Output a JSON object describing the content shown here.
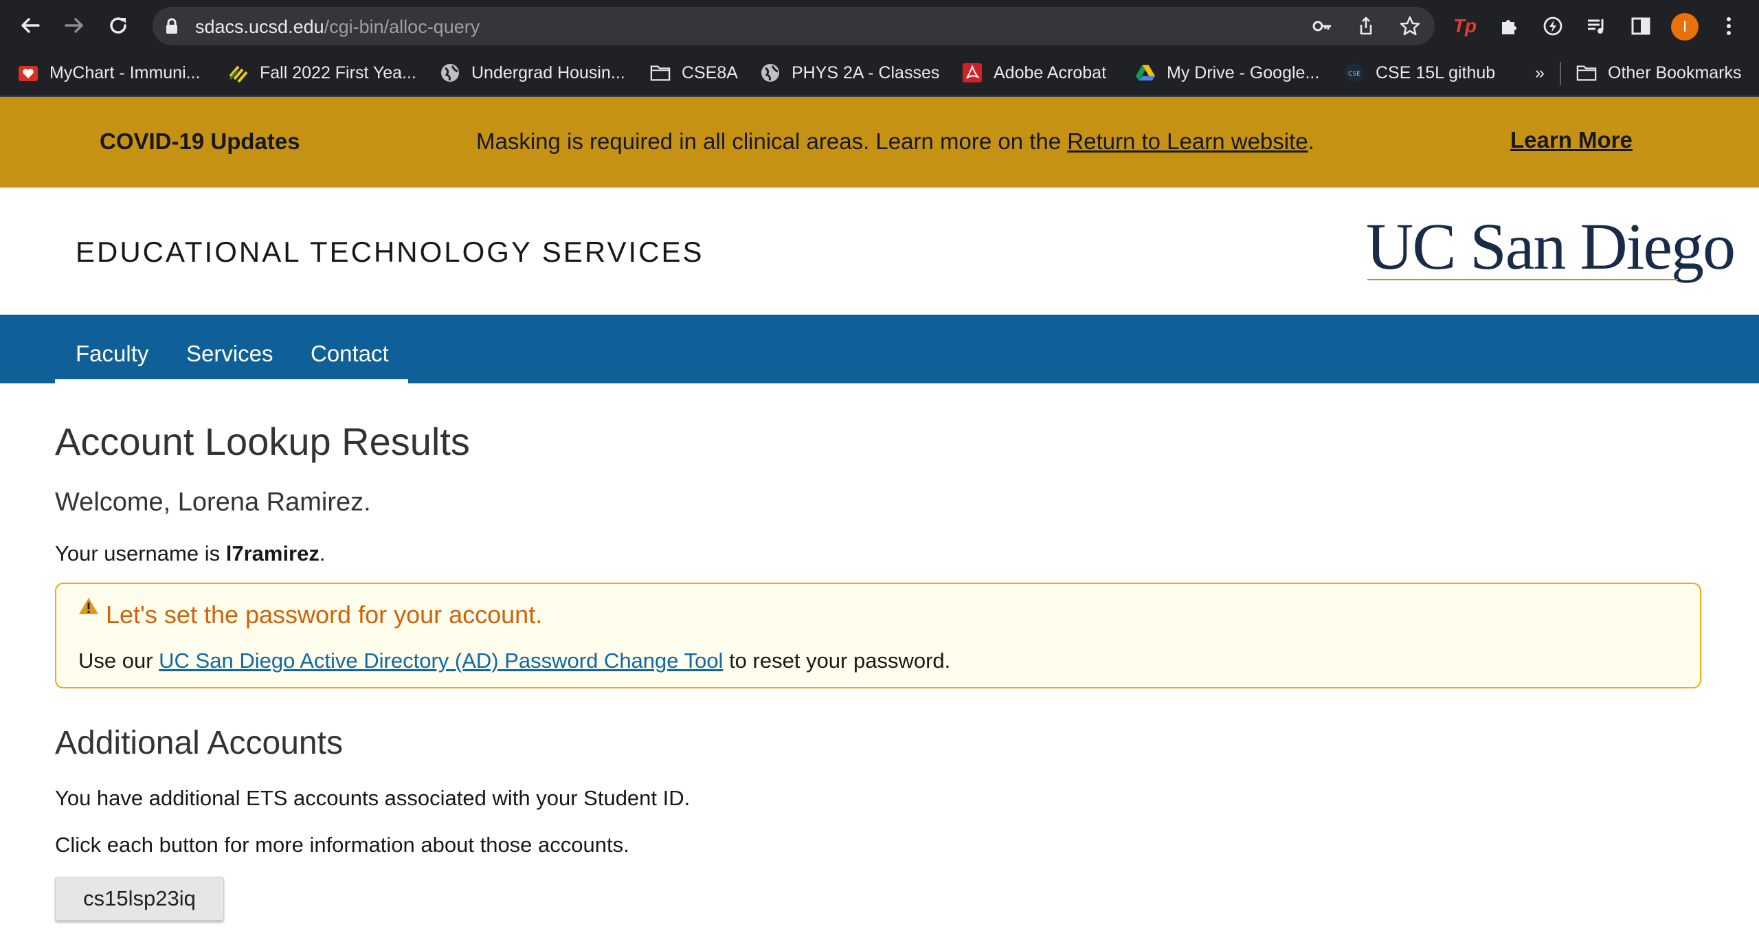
{
  "browser": {
    "url_domain": "sdacs.ucsd.edu",
    "url_path": "/cgi-bin/alloc-query",
    "profile_initial": "I",
    "bookmarks": [
      {
        "label": "MyChart - Immuni...",
        "icon": "mychart-icon"
      },
      {
        "label": "Fall 2022 First Yea...",
        "icon": "stripes-icon"
      },
      {
        "label": "Undergrad Housin...",
        "icon": "globe-icon"
      },
      {
        "label": "CSE8A",
        "icon": "folder-icon"
      },
      {
        "label": "PHYS 2A - Classes",
        "icon": "globe-icon"
      },
      {
        "label": "Adobe Acrobat",
        "icon": "acrobat-icon"
      },
      {
        "label": "My Drive - Google...",
        "icon": "drive-icon"
      },
      {
        "label": "CSE 15L github",
        "icon": "cse-icon"
      }
    ],
    "overflow_label": "»",
    "other_bookmarks": "Other Bookmarks"
  },
  "banner": {
    "title": "COVID-19 Updates",
    "message_before": "Masking is required in all clinical areas. Learn more on the ",
    "message_link": "Return to Learn website",
    "message_after": ".",
    "learn_more": "Learn More",
    "background": "#c69214"
  },
  "header": {
    "site_title": "EDUCATIONAL TECHNOLOGY SERVICES",
    "logo_text": "UC San Diego"
  },
  "nav": {
    "items": [
      "Faculty",
      "Services",
      "Contact"
    ],
    "background": "#0f6099"
  },
  "main": {
    "heading": "Account Lookup Results",
    "welcome": "Welcome, Lorena Ramirez.",
    "username_prefix": "Your username is ",
    "username": "l7ramirez",
    "username_suffix": ".",
    "alert": {
      "title": "Let's set the password for your account.",
      "body_before": "Use our ",
      "body_link": "UC San Diego Active Directory (AD) Password Change Tool",
      "body_after": " to reset your password."
    },
    "additional_heading": "Additional Accounts",
    "additional_text1": "You have additional ETS accounts associated with your Student ID.",
    "additional_text2": "Click each button for more information about those accounts.",
    "account_buttons": [
      "cs15lsp23iq"
    ]
  }
}
